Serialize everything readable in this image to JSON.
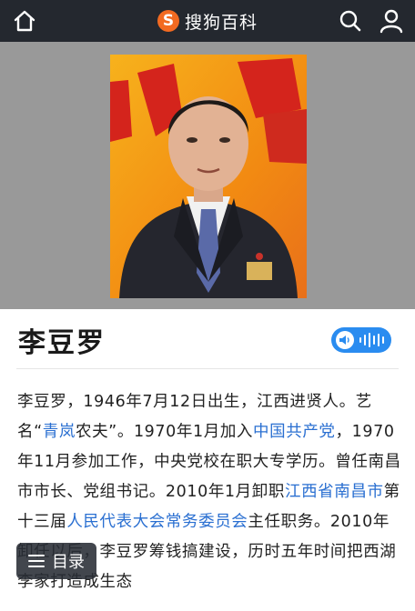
{
  "header": {
    "brand_logo_letter": "S",
    "brand_name": "搜狗百科",
    "brand_color": "#f26a21"
  },
  "entry": {
    "title": "李豆罗"
  },
  "summary": {
    "t1": "李豆罗，1946年7月12日出生，江西进贤人。艺名“",
    "l1": "青岚",
    "t2": "农夫”。1970年1月加入",
    "l2": "中国共产党",
    "t3": "，1970年11月参加工作，中央党校在职大专学历。曾任南昌市市长、党组书记。2010年1月卸职",
    "l3": "江西省南昌市",
    "t4": "第十三届",
    "l4": "人民代表大会常务委员会",
    "t5": "主任职务。2010年卸任以后，李豆罗筹钱搞建设，历时五年时间把西湖李家打造成生态"
  },
  "toc": {
    "label": "目录"
  },
  "colors": {
    "topbar": "#24282f",
    "link": "#2a6fd1",
    "audio": "#2a8cf0"
  }
}
